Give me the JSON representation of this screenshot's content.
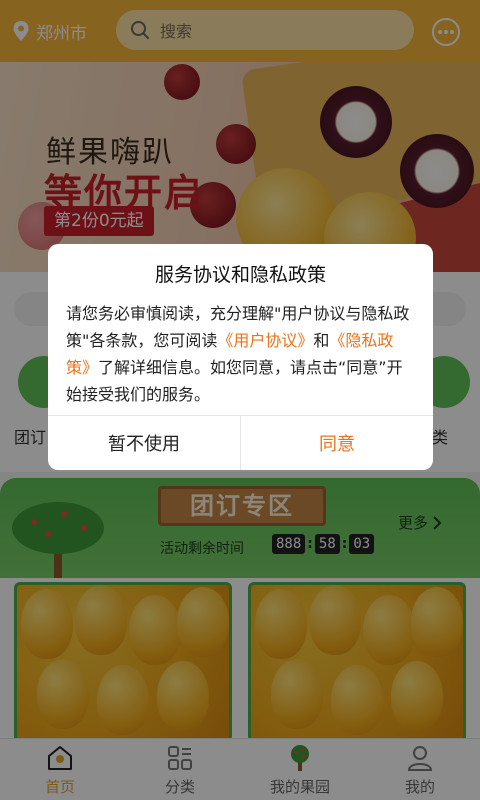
{
  "header": {
    "city": "郑州市",
    "search_placeholder": "搜索"
  },
  "banner": {
    "title_line1": "鲜果嗨趴",
    "title_line2": "等你开启",
    "promo_tag": "第2份0元起"
  },
  "quick_labels": {
    "left": "团订",
    "right": "类"
  },
  "group_section": {
    "title": "团订专区",
    "timer_label": "活动剩余时间",
    "timer": [
      "888",
      "58",
      "03"
    ],
    "more": "更多"
  },
  "tabbar": {
    "items": [
      {
        "label": "首页",
        "icon": "home-icon",
        "active": true
      },
      {
        "label": "分类",
        "icon": "category-icon",
        "active": false
      },
      {
        "label": "我的果园",
        "icon": "orchard-tree-icon",
        "active": false
      },
      {
        "label": "我的",
        "icon": "user-icon",
        "active": false
      }
    ]
  },
  "dialog": {
    "title": "服务协议和隐私政策",
    "body_part1": "请您务必审慎阅读，充分理解\"用户协议与隐私政策\"各条款，您可阅读",
    "link_user_agreement": "《用户协议》",
    "body_part2": "和",
    "link_privacy": "《隐私政策》",
    "body_part3": "了解详细信息。如您同意，请点击“同意”开始接受我们的服务。",
    "cancel_label": "暂不使用",
    "ok_label": "同意"
  },
  "colors": {
    "brand": "#f4b53a",
    "accent_link": "#e8731a",
    "green": "#5fbf57"
  }
}
